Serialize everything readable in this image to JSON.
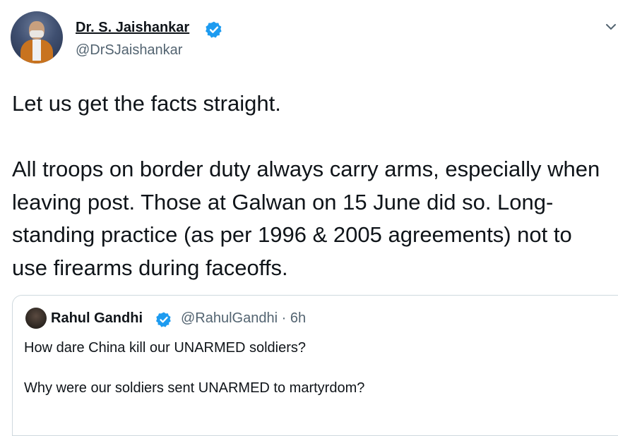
{
  "author": {
    "name": "Dr. S. Jaishankar",
    "handle": "@DrSJaishankar",
    "verified_icon": "verified-badge-icon",
    "accent_color": "#1d9bf0"
  },
  "menu_icon": "chevron-down-icon",
  "tweet": {
    "paragraphs": [
      "Let us get the facts straight.",
      "All troops on border duty always carry arms, especially when leaving post. Those at Galwan on 15 June did so. Long-standing practice (as per 1996 & 2005 agreements) not to use firearms during faceoffs."
    ]
  },
  "quoted_tweet": {
    "name": "Rahul Gandhi",
    "handle_time": "@RahulGandhi · 6h",
    "verified_icon": "verified-badge-icon",
    "lines": [
      "How dare China kill our UNARMED soldiers?",
      "Why were our soldiers sent UNARMED to martyrdom?"
    ]
  }
}
